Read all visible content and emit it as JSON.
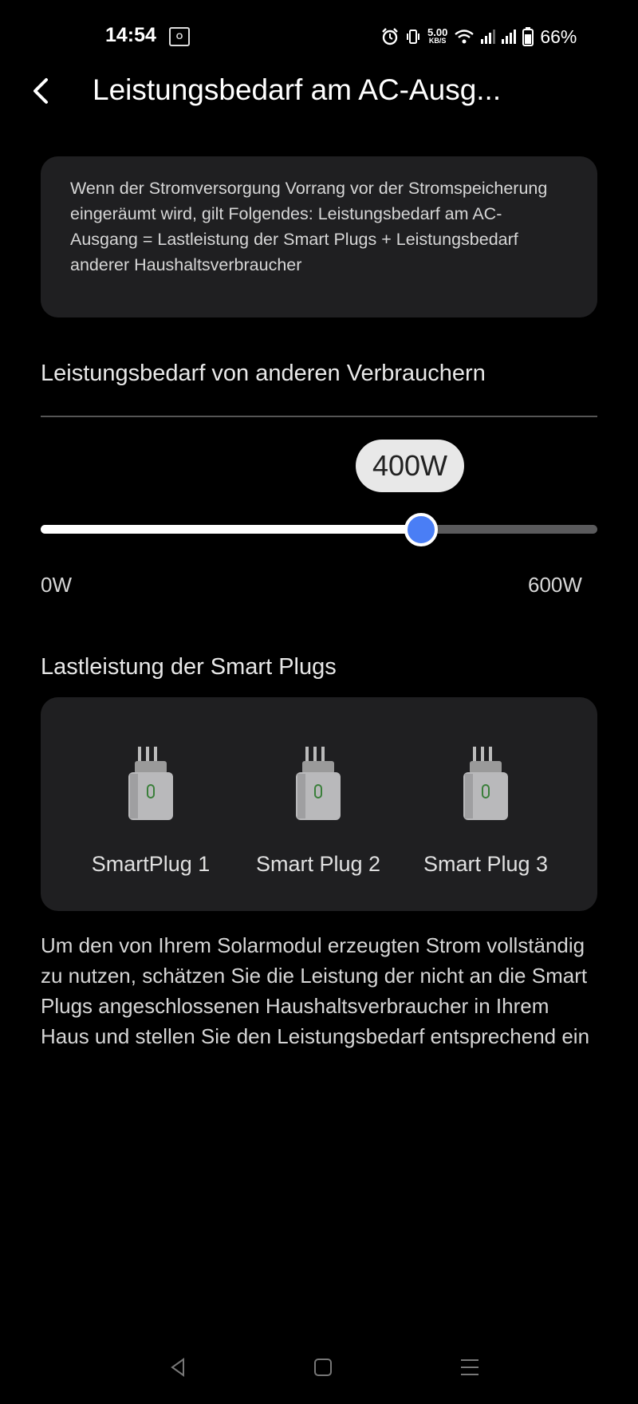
{
  "status_bar": {
    "time": "14:54",
    "notification_icon": "outlook-icon",
    "notification_glyph": "O",
    "speed_value": "5.00",
    "speed_unit": "KB/S",
    "battery": "66%"
  },
  "header": {
    "title": "Leistungsbedarf am AC-Ausg..."
  },
  "info_card": {
    "text": "Wenn der Stromversorgung Vorrang vor der Stromspeicherung eingeräumt wird, gilt Folgendes: Leistungsbedarf am AC-Ausgang = Lastleistung der Smart Plugs + Leistungsbedarf anderer Haushaltsverbraucher"
  },
  "other_consumers": {
    "heading": "Leistungsbedarf von anderen Verbrauchern",
    "slider": {
      "value_label": "400W",
      "value": 400,
      "min": 0,
      "max": 600,
      "min_label": "0W",
      "max_label": "600W"
    }
  },
  "smart_plugs": {
    "heading": "Lastleistung der Smart Plugs",
    "items": [
      {
        "label": "SmartPlug 1"
      },
      {
        "label": "Smart Plug 2"
      },
      {
        "label": "Smart Plug 3"
      }
    ]
  },
  "note": "Um den von Ihrem Solarmodul erzeugten Strom vollständig zu nutzen, schätzen Sie die Leistung der nicht an die Smart Plugs angeschlossenen Haushaltsverbraucher in Ihrem Haus und stellen Sie den Leistungsbedarf entsprechend ein",
  "colors": {
    "accent": "#4a7ef5",
    "card": "#1f1f21",
    "background": "#000000"
  }
}
